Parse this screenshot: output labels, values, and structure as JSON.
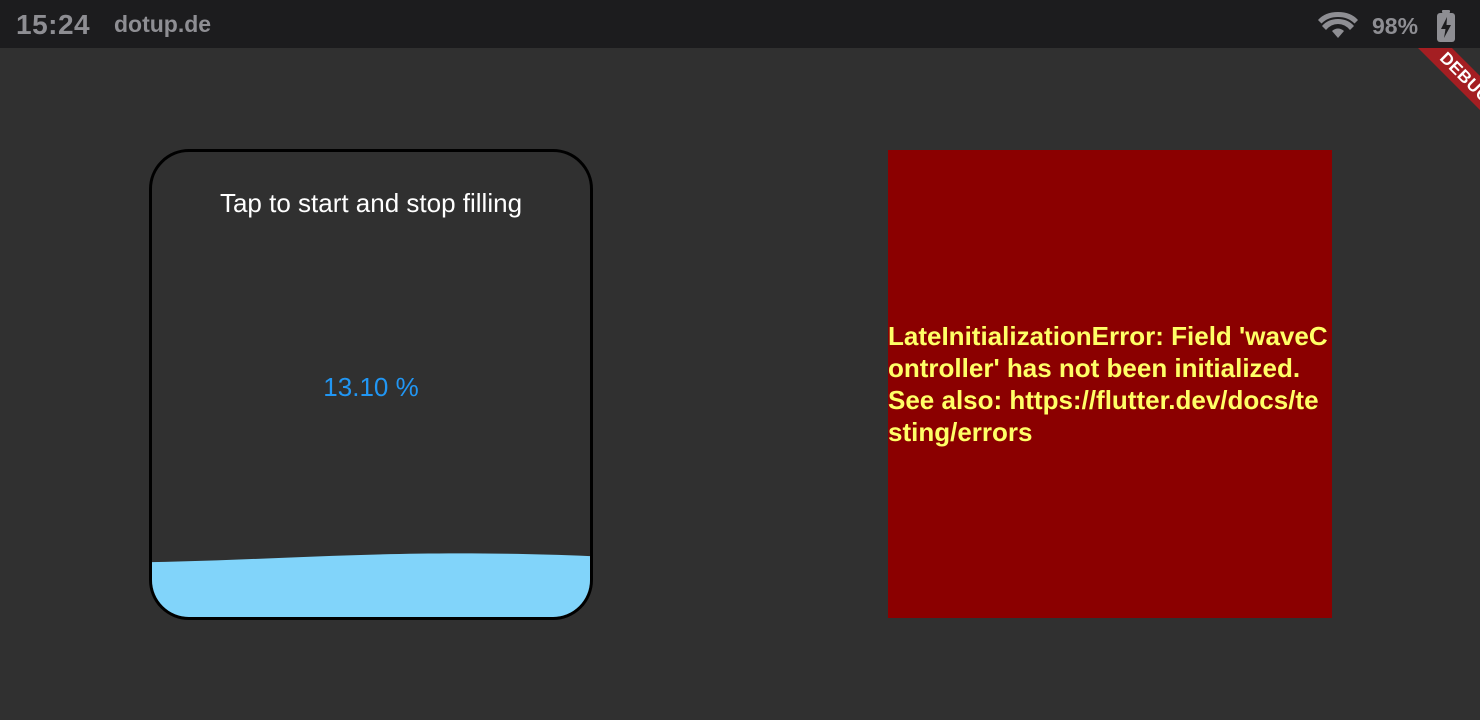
{
  "status_bar": {
    "time": "15:24",
    "host": "dotup.de",
    "battery_percent": "98%",
    "wifi_icon": "wifi-icon",
    "battery_icon": "battery-charging-icon"
  },
  "debug_banner": {
    "label": "DEBUG",
    "color": "#a41e22"
  },
  "fill_card": {
    "instructions": "Tap to start and stop filling",
    "percent_text": "13.10 %",
    "fill_fraction": 0.131,
    "wave_color": "#81d4fa",
    "percent_color": "#2196f3"
  },
  "error_box": {
    "message": "LateInitializationError: Field 'waveController' has not been initialized.\nSee also: https://flutter.dev/docs/testing/errors",
    "background": "#8b0000",
    "text_color": "#ffff66"
  }
}
